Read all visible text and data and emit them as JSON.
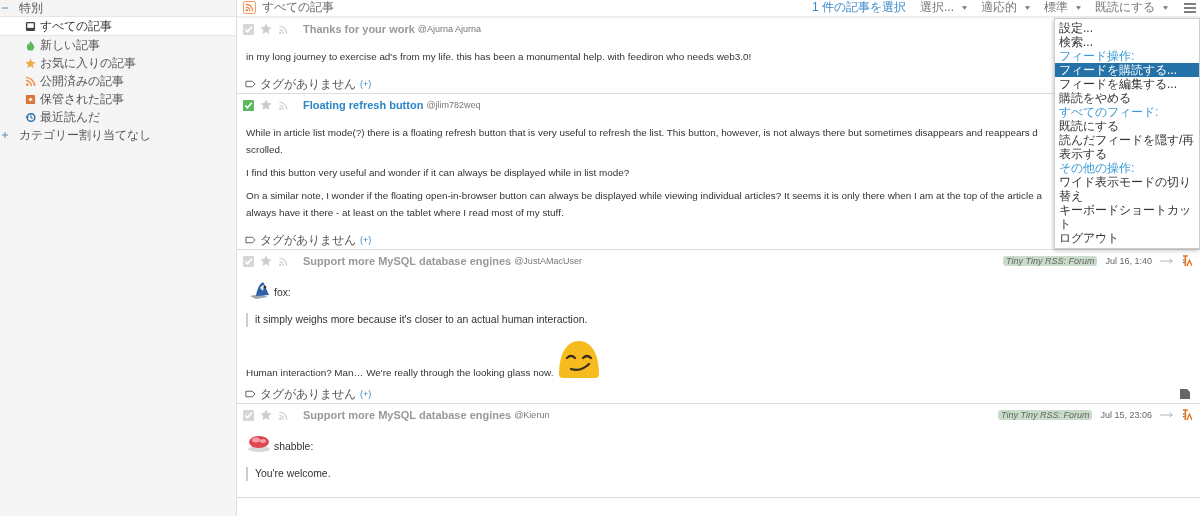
{
  "sidebar": {
    "category": {
      "label": "特別",
      "expanded": true
    },
    "items": [
      {
        "label": "すべての記事",
        "selected": true
      },
      {
        "label": "新しい記事",
        "selected": false
      },
      {
        "label": "お気に入りの記事",
        "selected": false
      },
      {
        "label": "公開済みの記事",
        "selected": false
      },
      {
        "label": "保管された記事",
        "selected": false
      },
      {
        "label": "最近読んだ",
        "selected": false
      }
    ],
    "uncategorized": {
      "label": "カテゴリー割り当てなし",
      "expanded": false
    }
  },
  "toolbar": {
    "feed_title": "すべての記事",
    "selection": "1 件の記事を選択",
    "dropdowns": [
      "選択...",
      "適応的",
      "標準",
      "既読にする"
    ]
  },
  "menu": [
    {
      "kind": "item",
      "label": "設定...",
      "selected": false
    },
    {
      "kind": "item",
      "label": "検索...",
      "selected": false
    },
    {
      "kind": "header",
      "label": "フィード操作:",
      "selected": false
    },
    {
      "kind": "item",
      "label": "フィードを購読する...",
      "selected": true
    },
    {
      "kind": "item",
      "label": "フィードを編集する...",
      "selected": false
    },
    {
      "kind": "item",
      "label": "購読をやめる",
      "selected": false
    },
    {
      "kind": "header",
      "label": "すべてのフィード:",
      "selected": false
    },
    {
      "kind": "item",
      "label": "既読にする",
      "selected": false
    },
    {
      "kind": "item",
      "label": "読んだフィードを隠す/再表示する",
      "selected": false
    },
    {
      "kind": "header",
      "label": "その他の操作:",
      "selected": false
    },
    {
      "kind": "item",
      "label": "ワイド表示モードの切り替え",
      "selected": false
    },
    {
      "kind": "item",
      "label": "キーボードショートカット",
      "selected": false
    },
    {
      "kind": "item",
      "label": "ログアウト",
      "selected": false
    }
  ],
  "articles": [
    {
      "title": "Thanks for your work",
      "author": "@Ajurna Ajurna",
      "checked": false,
      "starred": false,
      "blocks": [
        {
          "kind": "text",
          "lines": [
            "in my long journey to exercise ad's from my life. this has been a monumental help. with feediron who needs web3.0!"
          ]
        }
      ],
      "tags": "タグがありません",
      "tags_add": "(+)",
      "note": false
    },
    {
      "title": "Floating refresh button",
      "author": "@jlim782weq",
      "checked": true,
      "starred": false,
      "blocks": [
        {
          "kind": "text",
          "lines": [
            "While in article list mode(?) there is a floating refresh button that is very useful to refresh the list. This button, however, is not always there but sometimes disappears and reappears d",
            "scrolled."
          ]
        },
        {
          "kind": "text",
          "lines": [
            "I find this button very useful and wonder if it can always be displayed while in list mode?"
          ]
        },
        {
          "kind": "text",
          "lines": [
            "On a similar note, I wonder if the floating open-in-browser button can always be displayed while viewing individual articles? It seems it is only there when I am at the top of the article a",
            "always have it there - at least on the tablet where I read most of my stuff."
          ]
        }
      ],
      "tags": "タグがありません",
      "tags_add": "(+)",
      "note": false
    },
    {
      "title": "Support more MySQL database engines",
      "author": "@JustAMacUser",
      "checked": false,
      "starred": false,
      "feed": "Tiny Tiny RSS: Forum",
      "date": "Jul 16, 1:40",
      "blocks": [
        {
          "kind": "avatar",
          "lines": [
            "fox:"
          ]
        },
        {
          "kind": "quote",
          "lines": [
            "it simply weighs more because it's closer to an actual human interaction."
          ]
        },
        {
          "kind": "emoji",
          "lines": [
            "Human interaction? Man… We're really through the looking glass now."
          ]
        }
      ],
      "tags": "タグがありません",
      "tags_add": "(+)",
      "note": true
    },
    {
      "title": "Support more MySQL database engines",
      "author": "@Kierun",
      "checked": false,
      "starred": false,
      "feed": "Tiny Tiny RSS: Forum",
      "date": "Jul 15, 23:06",
      "blocks": [
        {
          "kind": "avatar2",
          "lines": [
            "shabble:"
          ]
        },
        {
          "kind": "quote",
          "lines": [
            "You're welcome."
          ]
        }
      ],
      "note": false
    }
  ]
}
